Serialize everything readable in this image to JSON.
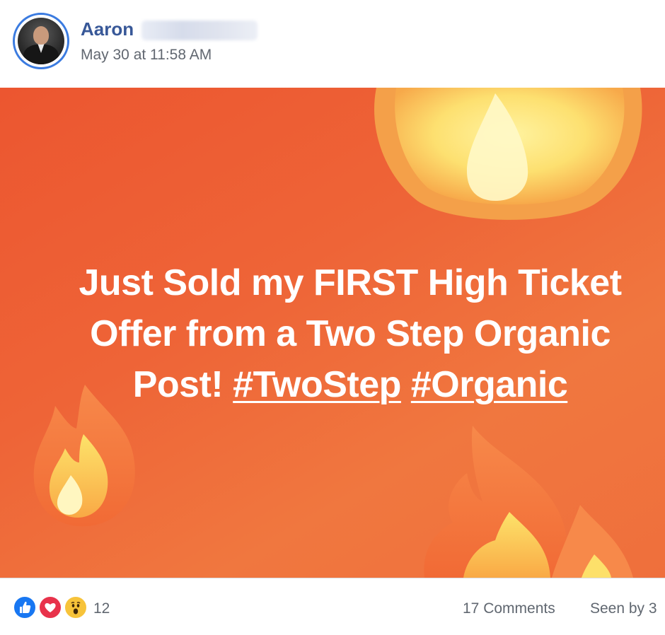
{
  "post": {
    "author": {
      "first_name": "Aaron",
      "avatar_icon": "profile-photo"
    },
    "timestamp": "May 30 at 11:58 AM",
    "banner": {
      "text_line1": "Just Sold my FIRST High Ticket",
      "text_line2": "Offer from a Two Step Organic",
      "text_line3_prefix": "Post! ",
      "hashtags": [
        "#TwoStep",
        "#Organic"
      ],
      "background_color": "#ee6437",
      "text_color": "#ffffff",
      "decoration_icon": "fire-emoji"
    },
    "footer": {
      "reaction_icons": [
        "like-icon",
        "love-icon",
        "wow-icon"
      ],
      "reaction_count": "12",
      "comments": "17 Comments",
      "seen_by": "Seen by 3"
    }
  },
  "colors": {
    "name_link": "#385898",
    "secondary_text": "#616770",
    "avatar_ring": "#3b7be0",
    "like": "#1877f2",
    "love": "#e8324b",
    "wow": "#f7c33a"
  }
}
